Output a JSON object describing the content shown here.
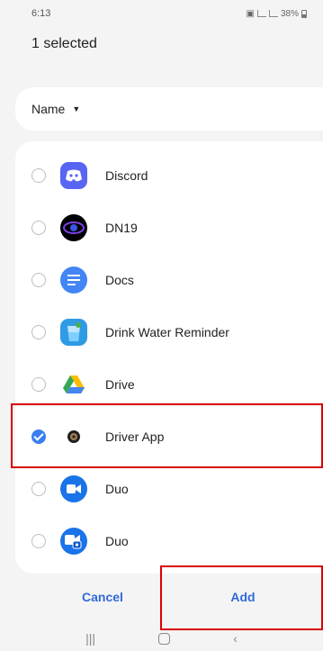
{
  "status_bar": {
    "time": "6:13",
    "battery": "38%"
  },
  "header": {
    "title": "1 selected"
  },
  "sort": {
    "label": "Name"
  },
  "apps": [
    {
      "name": "Discord",
      "icon": "discord-icon",
      "checked": false
    },
    {
      "name": "DN19",
      "icon": "dn19-icon",
      "checked": false
    },
    {
      "name": "Docs",
      "icon": "docs-icon",
      "checked": false
    },
    {
      "name": "Drink Water Reminder",
      "icon": "water-cup-icon",
      "checked": false
    },
    {
      "name": "Drive",
      "icon": "drive-icon",
      "checked": false
    },
    {
      "name": "Driver App",
      "icon": "driver-app-icon",
      "checked": true
    },
    {
      "name": "Duo",
      "icon": "duo-icon",
      "checked": false
    },
    {
      "name": "Duo",
      "icon": "duo-alt-icon",
      "checked": false
    }
  ],
  "actions": {
    "cancel": "Cancel",
    "add": "Add"
  },
  "colors": {
    "accent": "#3069d8",
    "checked": "#3a7ff0",
    "highlight": "#d90000"
  }
}
